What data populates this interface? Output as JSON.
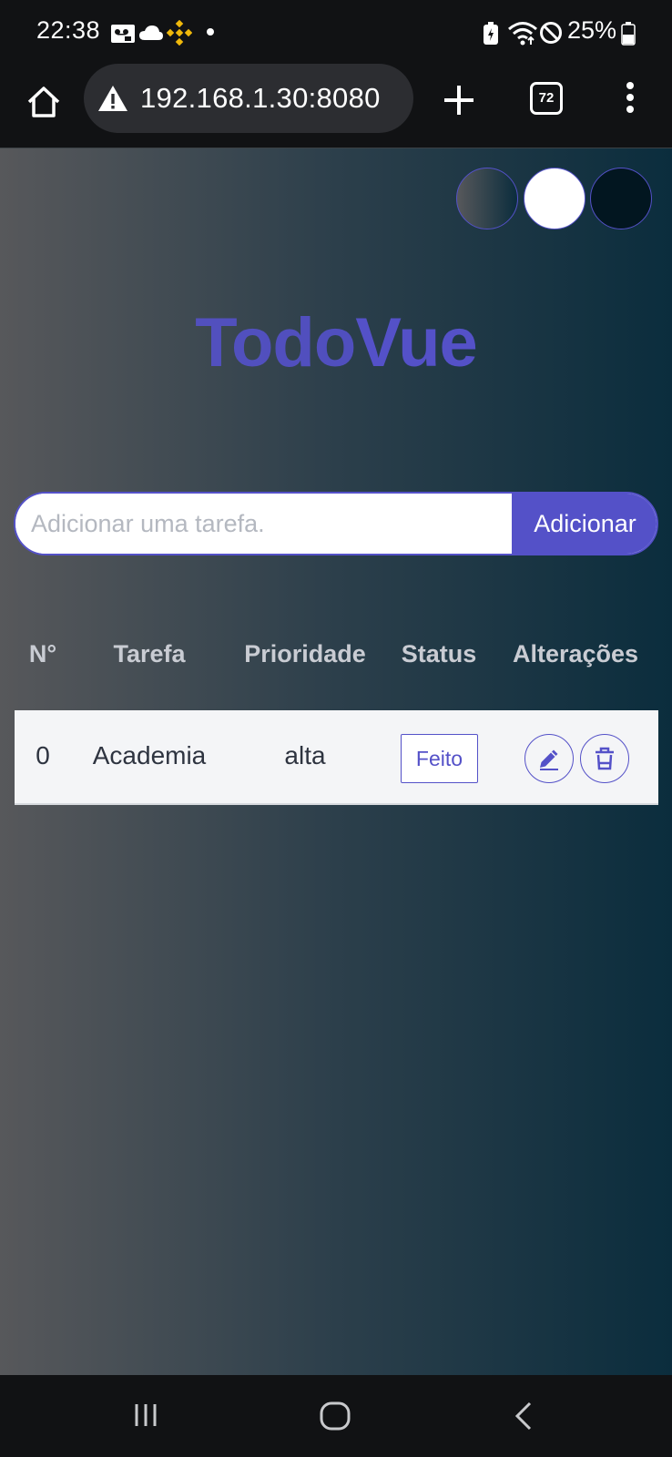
{
  "status_bar": {
    "time": "22:38",
    "battery": "25%",
    "icons": [
      "voicemail-icon",
      "cloud-icon",
      "binance-icon",
      "notification-dot",
      "battery-saver-icon",
      "wifi-icon",
      "do-not-disturb-icon",
      "battery-icon"
    ]
  },
  "browser": {
    "url": "192.168.1.30:8080",
    "tab_count": "72",
    "icons": [
      "home-icon",
      "warning-icon",
      "plus-icon",
      "tabs-icon",
      "more-vert-icon"
    ]
  },
  "theme_buttons": [
    "gradient",
    "light",
    "dark"
  ],
  "app": {
    "title_part1": "Todo",
    "title_part2": "Vue",
    "accent_color": "#5451c8"
  },
  "form": {
    "input_placeholder": "Adicionar uma tarefa.",
    "input_value": "",
    "add_label": "Adicionar"
  },
  "table": {
    "headers": [
      "N°",
      "Tarefa",
      "Prioridade",
      "Status",
      "Alterações"
    ],
    "rows": [
      {
        "index": "0",
        "task": "Academia",
        "priority": "alta",
        "status": "Feito",
        "actions": [
          "edit-icon",
          "trash-icon"
        ]
      }
    ]
  },
  "nav_bar": {
    "icons": [
      "recents-icon",
      "home-circle-icon",
      "back-icon"
    ]
  }
}
